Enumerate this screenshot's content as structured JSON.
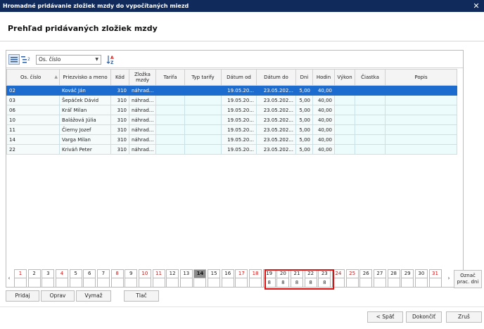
{
  "window": {
    "title": "Hromadné pridávanie zložiek mzdy do vypočítaných miezd",
    "close": "✕"
  },
  "heading": "Prehľad pridávaných zložiek mzdy",
  "toolbar": {
    "sort_value": "Os. číslo",
    "sort_icon": "sort-az-icon",
    "group_icon": "group-icon",
    "list_icon": "list-icon"
  },
  "table": {
    "columns": [
      "Os. číslo",
      "Priezvisko a meno",
      "Kód",
      "Zložka mzdy",
      "Tarifa",
      "Typ tarify",
      "Dátum od",
      "Dátum do",
      "Dni",
      "Hodin",
      "Výkon",
      "Čiastka",
      "Popis"
    ],
    "rows": [
      [
        "02",
        "Kováč Ján",
        "310",
        "náhrad...",
        "",
        "",
        "19.05.20...",
        "23.05.202...",
        "5,00",
        "40,00",
        "",
        "",
        ""
      ],
      [
        "03",
        "Šepáček Dávid",
        "310",
        "náhrad...",
        "",
        "",
        "19.05.20...",
        "23.05.202...",
        "5,00",
        "40,00",
        "",
        "",
        ""
      ],
      [
        "06",
        "Kráľ Milan",
        "310",
        "náhrad...",
        "",
        "",
        "19.05.20...",
        "23.05.202...",
        "5,00",
        "40,00",
        "",
        "",
        ""
      ],
      [
        "10",
        "Balážová Júlia",
        "310",
        "náhrad...",
        "",
        "",
        "19.05.20...",
        "23.05.202...",
        "5,00",
        "40,00",
        "",
        "",
        ""
      ],
      [
        "11",
        "Čierny Jozef",
        "310",
        "náhrad...",
        "",
        "",
        "19.05.20...",
        "23.05.202...",
        "5,00",
        "40,00",
        "",
        "",
        ""
      ],
      [
        "14",
        "Varga Milan",
        "310",
        "náhrad...",
        "",
        "",
        "19.05.20...",
        "23.05.202...",
        "5,00",
        "40,00",
        "",
        "",
        ""
      ],
      [
        "22",
        "Kriváň Peter",
        "310",
        "náhrad...",
        "",
        "",
        "19.05.20...",
        "23.05.202...",
        "5,00",
        "40,00",
        "",
        "",
        ""
      ]
    ],
    "selected_row": 0
  },
  "calendar": {
    "prev": "‹",
    "next": "›",
    "days": [
      {
        "n": "1",
        "red": true,
        "v": ""
      },
      {
        "n": "2",
        "red": false,
        "v": ""
      },
      {
        "n": "3",
        "red": false,
        "v": ""
      },
      {
        "n": "4",
        "red": true,
        "v": ""
      },
      {
        "n": "5",
        "red": false,
        "v": ""
      },
      {
        "n": "6",
        "red": false,
        "v": ""
      },
      {
        "n": "7",
        "red": false,
        "v": ""
      },
      {
        "n": "8",
        "red": true,
        "v": ""
      },
      {
        "n": "9",
        "red": false,
        "v": ""
      },
      {
        "n": "10",
        "red": true,
        "v": ""
      },
      {
        "n": "11",
        "red": true,
        "v": ""
      },
      {
        "n": "12",
        "red": false,
        "v": ""
      },
      {
        "n": "13",
        "red": false,
        "v": ""
      },
      {
        "n": "14",
        "red": false,
        "today": true,
        "v": ""
      },
      {
        "n": "15",
        "red": false,
        "v": ""
      },
      {
        "n": "16",
        "red": false,
        "v": ""
      },
      {
        "n": "17",
        "red": true,
        "v": ""
      },
      {
        "n": "18",
        "red": true,
        "v": ""
      },
      {
        "n": "19",
        "red": false,
        "v": "8"
      },
      {
        "n": "20",
        "red": false,
        "v": "8"
      },
      {
        "n": "21",
        "red": false,
        "v": "8"
      },
      {
        "n": "22",
        "red": false,
        "v": "8"
      },
      {
        "n": "23",
        "red": false,
        "v": "8"
      },
      {
        "n": "24",
        "red": true,
        "v": ""
      },
      {
        "n": "25",
        "red": true,
        "v": ""
      },
      {
        "n": "26",
        "red": false,
        "v": ""
      },
      {
        "n": "27",
        "red": false,
        "v": ""
      },
      {
        "n": "28",
        "red": false,
        "v": ""
      },
      {
        "n": "29",
        "red": false,
        "v": ""
      },
      {
        "n": "30",
        "red": false,
        "v": ""
      },
      {
        "n": "31",
        "red": true,
        "v": ""
      }
    ],
    "mark_line1": "Označ",
    "mark_line2": "prac. dni"
  },
  "actions": {
    "add": "Pridaj",
    "edit": "Oprav",
    "delete": "Vymaž",
    "print": "Tlač"
  },
  "footer": {
    "back": "< Späť",
    "finish": "Dokončiť",
    "cancel": "Zruš"
  }
}
